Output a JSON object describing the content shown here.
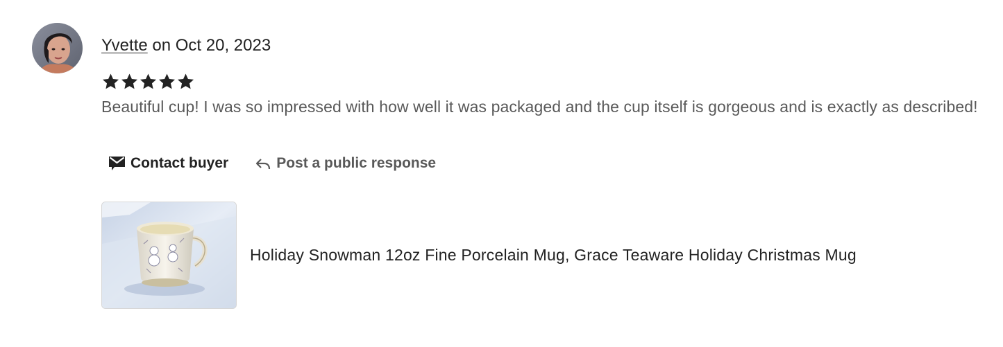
{
  "review": {
    "reviewer_name": "Yvette",
    "date_text": " on Oct 20, 2023",
    "rating": 5,
    "rating_max": 5,
    "text": "Beautiful cup! I was so impressed with how well it was packaged and the cup itself is gorgeous and is exactly as described!"
  },
  "actions": {
    "contact_label": "Contact buyer",
    "contact_icon": "envelope-icon",
    "respond_label": "Post a public response",
    "respond_icon": "reply-arrow-icon"
  },
  "product": {
    "title": "Holiday Snowman 12oz Fine Porcelain Mug, Grace Teaware Holiday Christmas Mug"
  },
  "colors": {
    "primary_text": "#222222",
    "secondary_text": "#595959",
    "star": "#222222"
  }
}
